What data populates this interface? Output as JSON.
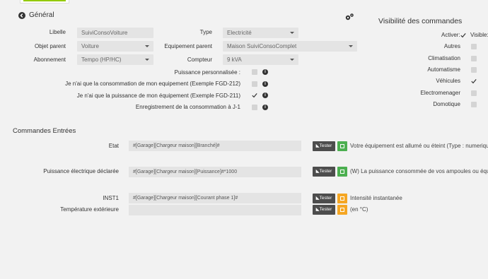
{
  "header": {
    "back_label": "Général"
  },
  "form": {
    "libelle_label": "Libelle",
    "libelle_value": "SuiviConsoVoiture",
    "objet_label": "Objet parent",
    "objet_value": "Voiture",
    "abonnement_label": "Abonnement",
    "abonnement_value": "Tempo (HP/HC)",
    "type_label": "Type",
    "type_value": "Electricité",
    "equip_label": "Equipement parent",
    "equip_value": "Maison SuiviConsoComplet",
    "compteur_label": "Compteur",
    "compteur_value": "9 kVA",
    "opt1_label": "Puissance personnalisée :",
    "opt2_label": "Je n'ai que la consommation de mon equipement (Exemple FGD-212)",
    "opt3_label": "Je n'ai que la puissance de mon équipement (Exemple FGD-211)",
    "opt4_label": "Enregistrement de la consommation à J-1"
  },
  "visibility": {
    "title": "Visibilité des commandes",
    "activer_label": "Activer:",
    "visible_label": "Visible:",
    "items": [
      {
        "label": "Autres",
        "checked": false
      },
      {
        "label": "Climatisation",
        "checked": false
      },
      {
        "label": "Automatisme",
        "checked": false
      },
      {
        "label": "Véhicules",
        "checked": true
      },
      {
        "label": "Electromenager",
        "checked": false
      },
      {
        "label": "Domotique",
        "checked": false
      }
    ]
  },
  "commands": {
    "title": "Commandes Entrées",
    "test_label": "Tester",
    "rows": [
      {
        "label": "Etat",
        "value": "#[Garage][Chargeur maison][Branché]#",
        "desc": "Votre équipement est allumé ou éteint (Type : numerique",
        "color": "green"
      },
      {
        "label": "Puissance électrique déclarée",
        "value": "#[Garage][Chargeur maison][Puissance]#*1000",
        "desc": "(W) La puissance consommée de vos ampoules ou équip",
        "color": "green"
      },
      {
        "label": "INST1",
        "value": "#[Garage][Chargeur maison][Courant phase 1]#",
        "desc": "Intensité instantanée",
        "color": "orange"
      },
      {
        "label": "Température extérieure",
        "value": "",
        "desc": "(en °C)",
        "color": "orange"
      }
    ]
  },
  "colors": {
    "accent": "#94ca02",
    "green": "#4caf50",
    "orange": "#f5a623",
    "button": "#4d4d4d"
  }
}
